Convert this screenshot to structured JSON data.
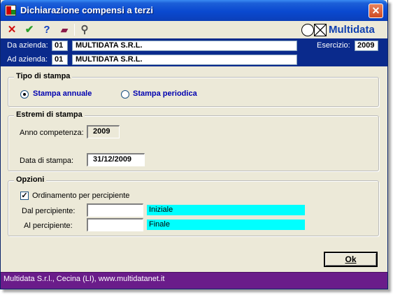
{
  "window": {
    "title": "Dichiarazione compensi a terzi",
    "close_glyph": "✕"
  },
  "toolbar": {
    "cancel_icon": "red-x-icon",
    "confirm_icon": "green-check-icon",
    "help_icon": "question-mark-icon",
    "book_icon": "book-icon",
    "search_icon": "binoculars-icon",
    "cancel_glyph": "✕",
    "confirm_glyph": "✔",
    "help_glyph": "?",
    "book_glyph": "▰",
    "search_glyph": "⚲",
    "logo_text": "Multidata"
  },
  "header": {
    "da_azienda_label": "Da azienda:",
    "da_azienda_code": "01",
    "da_azienda_name": "MULTIDATA S.R.L.",
    "ad_azienda_label": "Ad azienda:",
    "ad_azienda_code": "01",
    "ad_azienda_name": "MULTIDATA S.R.L.",
    "esercizio_label": "Esercizio:",
    "esercizio_value": "2009"
  },
  "tipo_stampa": {
    "title": "Tipo di stampa",
    "option_annuale": "Stampa annuale",
    "option_periodica": "Stampa periodica",
    "selected": "annuale"
  },
  "estremi": {
    "title": "Estremi di stampa",
    "anno_label": "Anno competenza:",
    "anno_value": "2009",
    "data_label": "Data di stampa:",
    "data_value": "31/12/2009"
  },
  "opzioni": {
    "title": "Opzioni",
    "ordinamento_label": "Ordinamento per percipiente",
    "ordinamento_checked": true,
    "check_glyph": "✓",
    "dal_label": "Dal percipiente:",
    "dal_value": "",
    "dal_desc": "Iniziale",
    "al_label": "Al percipiente:",
    "al_value": "",
    "al_desc": "Finale"
  },
  "actions": {
    "ok_label": "Ok"
  },
  "status": {
    "text": "Multidata S.r.l., Cecina (LI), www.multidatanet.it"
  },
  "colors": {
    "title_bar": "#0a49d0",
    "header_band": "#0a2a8c",
    "status_bar": "#6a1c8a",
    "description_fill": "#00ffff",
    "radio_label": "#0000b0"
  }
}
